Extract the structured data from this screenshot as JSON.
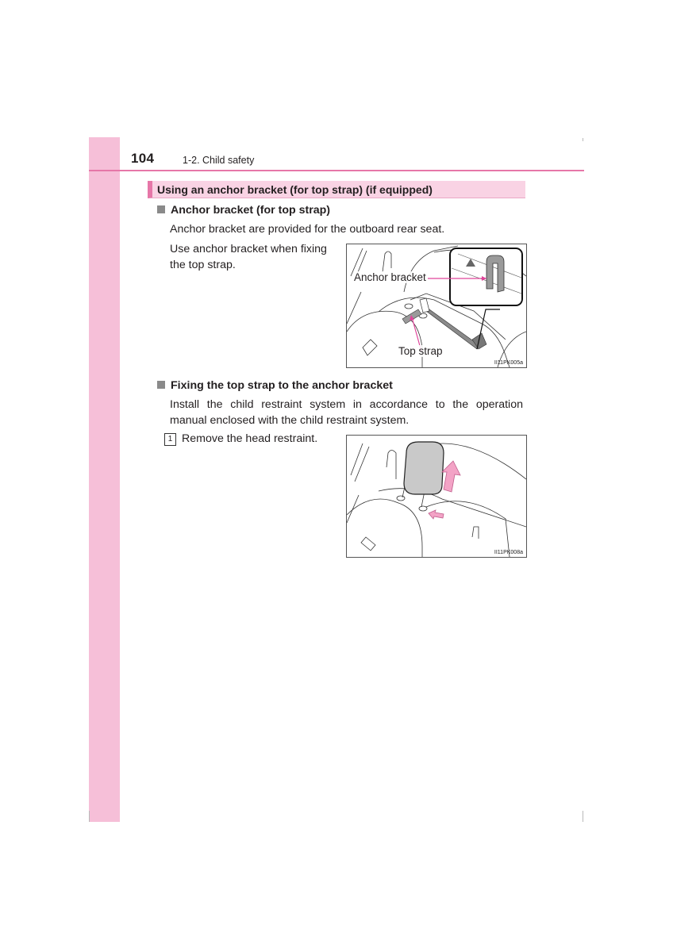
{
  "header": {
    "page_number": "104",
    "chapter": "1-2. Child safety"
  },
  "section": {
    "title": "Using an anchor bracket (for top strap) (if equipped)"
  },
  "subsections": [
    {
      "title": "Anchor bracket (for top strap)",
      "paragraphs": [
        "Anchor bracket are provided for the outboard rear seat.",
        "Use anchor bracket when fixing",
        "the top strap."
      ],
      "figure": {
        "code": "II11PK005a",
        "callouts": [
          "Anchor bracket",
          "Top strap"
        ]
      }
    },
    {
      "title": "Fixing the top strap to the anchor bracket",
      "paragraphs": [
        "Install the child restraint system in accordance to the operation",
        "manual enclosed with the child restraint system."
      ],
      "steps": [
        {
          "number": "1",
          "text": "Remove the head restraint."
        }
      ],
      "figure": {
        "code": "II11PK008a"
      }
    }
  ],
  "colors": {
    "accent": "#e677a8",
    "sidebar": "#f6bfd8",
    "heading_bg": "#f9d3e4"
  }
}
